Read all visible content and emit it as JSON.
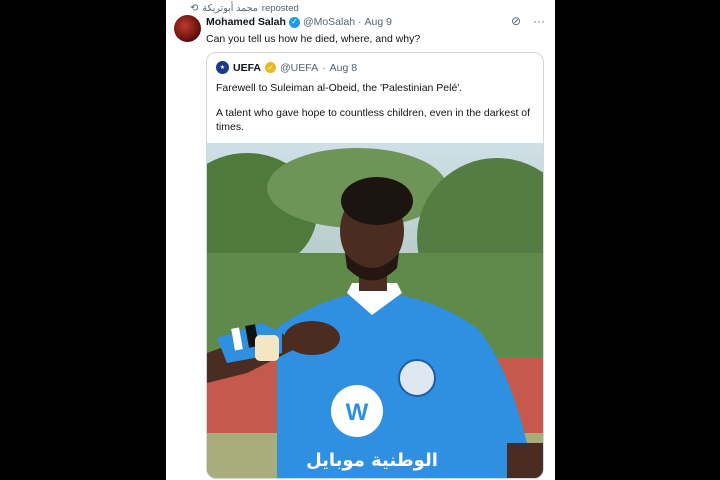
{
  "repost": {
    "icon": "repost-icon",
    "user": "محمد أبوتريكة",
    "suffix": "reposted"
  },
  "tweet": {
    "name": "Mohamed Salah",
    "handle": "@MoSalah",
    "sep": "·",
    "date": "Aug 9",
    "text": "Can you tell us how he died, where, and why?"
  },
  "quote": {
    "name": "UEFA",
    "handle": "@UEFA",
    "sep": "·",
    "date": "Aug 8",
    "line1": "Farewell to Suleiman al-Obeid, the 'Palestinian Pelé'.",
    "line2": "A talent who gave hope to countless children, even in the darkest of times."
  },
  "jersey_sponsor": "الوطنية موبايل",
  "colors": {
    "accent": "#1d9bf0",
    "jersey": "#2f8fe0",
    "gold": "#e8b923"
  }
}
